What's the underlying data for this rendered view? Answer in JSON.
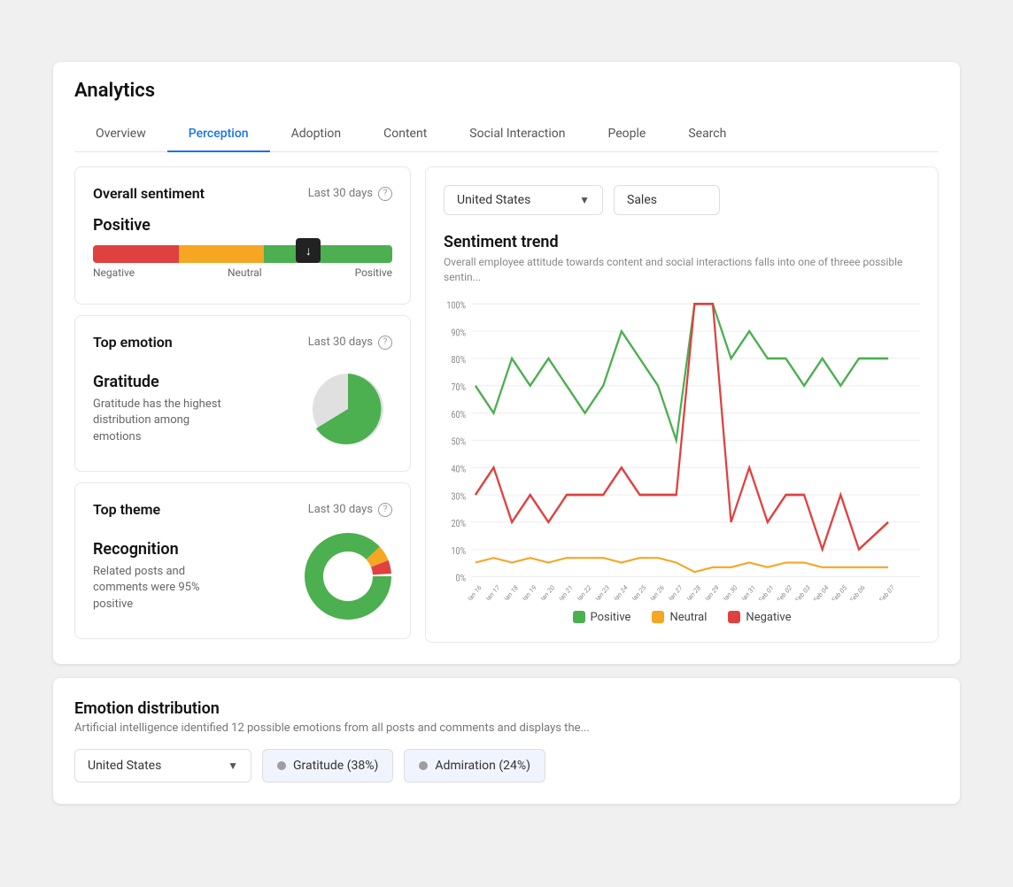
{
  "app": {
    "title": "Analytics"
  },
  "tabs": [
    {
      "id": "overview",
      "label": "Overview",
      "active": false
    },
    {
      "id": "perception",
      "label": "Perception",
      "active": true
    },
    {
      "id": "adoption",
      "label": "Adoption",
      "active": false
    },
    {
      "id": "content",
      "label": "Content",
      "active": false
    },
    {
      "id": "social-interaction",
      "label": "Social Interaction",
      "active": false
    },
    {
      "id": "people",
      "label": "People",
      "active": false
    },
    {
      "id": "search",
      "label": "Search",
      "active": false
    }
  ],
  "overall_sentiment": {
    "title": "Overall sentiment",
    "period": "Last 30 days",
    "value": "Positive",
    "bar_labels": {
      "negative": "Negative",
      "neutral": "Neutral",
      "positive": "Positive"
    }
  },
  "top_emotion": {
    "title": "Top emotion",
    "period": "Last 30 days",
    "emotion": "Gratitude",
    "description": "Gratitude has the highest distribution among emotions"
  },
  "top_theme": {
    "title": "Top theme",
    "period": "Last 30 days",
    "theme": "Recognition",
    "description": "Related posts and comments were 95% positive"
  },
  "sentiment_trend": {
    "title": "Sentiment trend",
    "subtitle": "Overall employee attitude towards content and social interactions falls into one of threee possible sentin...",
    "filter_country": "United States",
    "filter_sales": "Sales",
    "y_labels": [
      "100%",
      "90%",
      "80%",
      "70%",
      "60%",
      "50%",
      "40%",
      "30%",
      "20%",
      "10%",
      "0%"
    ],
    "x_labels": [
      "Jan 16",
      "Jan 17",
      "Jan 18",
      "Jan 19",
      "Jan 20",
      "Jan 21",
      "Jan 22",
      "Jan 23",
      "Jan 24",
      "Jan 25",
      "Jan 26",
      "Jan 27",
      "Jan 28",
      "Jan 29",
      "Jan 30",
      "Jan 31",
      "Feb 01",
      "Feb 02",
      "Feb 03",
      "Feb 04",
      "Feb 05",
      "Feb 06",
      "Feb 07"
    ],
    "legend": {
      "positive": "Positive",
      "neutral": "Neutral",
      "negative": "Negative"
    },
    "colors": {
      "positive": "#4caf50",
      "neutral": "#f5a623",
      "negative": "#e04040"
    }
  },
  "emotion_distribution": {
    "title": "Emotion distribution",
    "subtitle": "Artificial intelligence identified 12 possible emotions from all posts and comments and displays the...",
    "filter_country": "United States",
    "badges": [
      {
        "label": "Gratitude (38%)",
        "color": "#9e9e9e"
      },
      {
        "label": "Admiration (24%)",
        "color": "#9e9e9e"
      }
    ]
  }
}
